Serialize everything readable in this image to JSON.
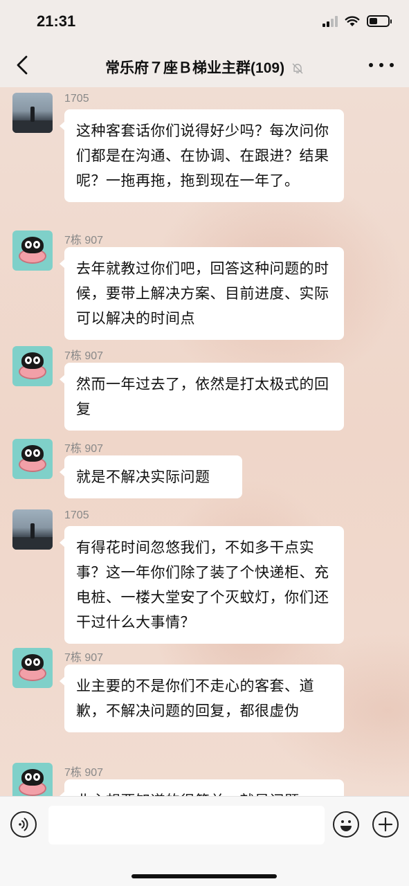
{
  "status_bar": {
    "time": "21:31"
  },
  "header": {
    "title": "常乐府７座Ｂ梯业主群(109)"
  },
  "messages": [
    {
      "sender": "1705",
      "avatar": "photo",
      "text": "这种客套话你们说得好少吗？每次问你们都是在沟通、在协调、在跟进？结果呢？一拖再拖，拖到现在一年了。"
    },
    {
      "sender": "7栋 907",
      "avatar": "cat",
      "text": "去年就教过你们吧，回答这种问题的时候，要带上解决方案、目前进度、实际可以解决的时间点"
    },
    {
      "sender": "7栋 907",
      "avatar": "cat",
      "text": "然而一年过去了，依然是打太极式的回复"
    },
    {
      "sender": "7栋 907",
      "avatar": "cat",
      "text": "就是不解决实际问题"
    },
    {
      "sender": "1705",
      "avatar": "photo",
      "text": "有得花时间忽悠我们，不如多干点实事？这一年你们除了装了个快递柜、充电桩、一楼大堂安了个灭蚊灯，你们还干过什么大事情？"
    },
    {
      "sender": "7栋 907",
      "avatar": "cat",
      "text": "业主要的不是你们不走心的客套、道歉，不解决问题的回复，都很虚伪"
    },
    {
      "sender": "7栋 907",
      "avatar": "cat",
      "text": "业主想要知道的很简单，就是问题"
    }
  ],
  "input": {
    "value": ""
  }
}
